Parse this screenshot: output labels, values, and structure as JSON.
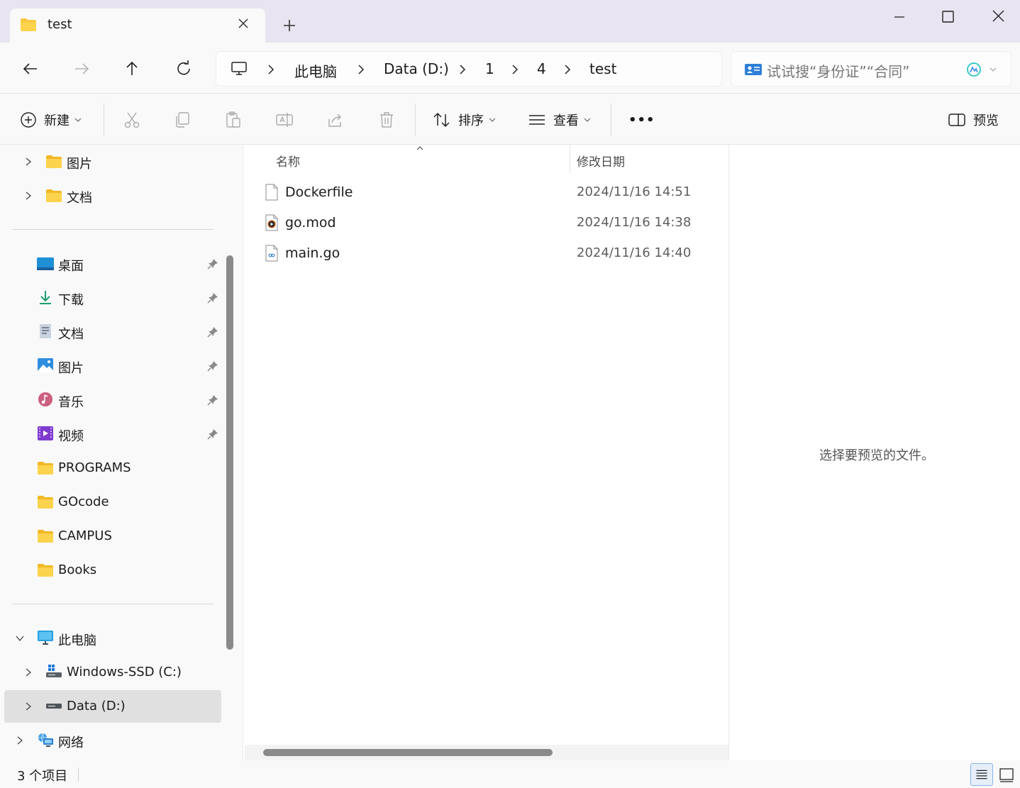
{
  "tab": {
    "title": "test",
    "icon": "folder-icon"
  },
  "nav": {
    "breadcrumbs": [
      "此电脑",
      "Data (D:)",
      "1",
      "4",
      "test"
    ],
    "search_placeholder": "试试搜“身份证”“合同”"
  },
  "commands": {
    "new_label": "新建",
    "sort_label": "排序",
    "view_label": "查看",
    "more_label": "•••",
    "preview_label": "预览"
  },
  "sidebar": {
    "top_items": [
      {
        "label": "图片",
        "icon": "folder-icon"
      },
      {
        "label": "文档",
        "icon": "folder-icon"
      }
    ],
    "quick_access": [
      {
        "label": "桌面",
        "icon": "desktop-icon",
        "pinned": true
      },
      {
        "label": "下载",
        "icon": "download-icon",
        "pinned": true
      },
      {
        "label": "文档",
        "icon": "documents-icon",
        "pinned": true
      },
      {
        "label": "图片",
        "icon": "pictures-icon",
        "pinned": true
      },
      {
        "label": "音乐",
        "icon": "music-icon",
        "pinned": true
      },
      {
        "label": "视频",
        "icon": "videos-icon",
        "pinned": true
      },
      {
        "label": "PROGRAMS",
        "icon": "folder-icon",
        "pinned": false
      },
      {
        "label": "GOcode",
        "icon": "folder-icon",
        "pinned": false
      },
      {
        "label": "CAMPUS",
        "icon": "folder-icon",
        "pinned": false
      },
      {
        "label": "Books",
        "icon": "folder-icon",
        "pinned": false
      }
    ],
    "this_pc": {
      "label": "此电脑",
      "icon": "computer-icon"
    },
    "drives": [
      {
        "label": "Windows-SSD (C:)",
        "icon": "windows-drive-icon"
      },
      {
        "label": "Data (D:)",
        "icon": "drive-icon",
        "selected": true
      }
    ],
    "network": {
      "label": "网络",
      "icon": "network-icon"
    }
  },
  "files": {
    "columns": {
      "name": "名称",
      "modified": "修改日期"
    },
    "rows": [
      {
        "name": "Dockerfile",
        "modified": "2024/11/16 14:51",
        "icon": "file-icon"
      },
      {
        "name": "go.mod",
        "modified": "2024/11/16 14:38",
        "icon": "media-file-icon"
      },
      {
        "name": "main.go",
        "modified": "2024/11/16 14:40",
        "icon": "go-file-icon"
      }
    ]
  },
  "preview": {
    "message": "选择要预览的文件。"
  },
  "status": {
    "item_count": "3 个项目"
  },
  "colors": {
    "accent": "#0067c0",
    "titlebar": "#e9e4f1",
    "folder": "#f8c73e",
    "selected": "#e0e0e0"
  }
}
